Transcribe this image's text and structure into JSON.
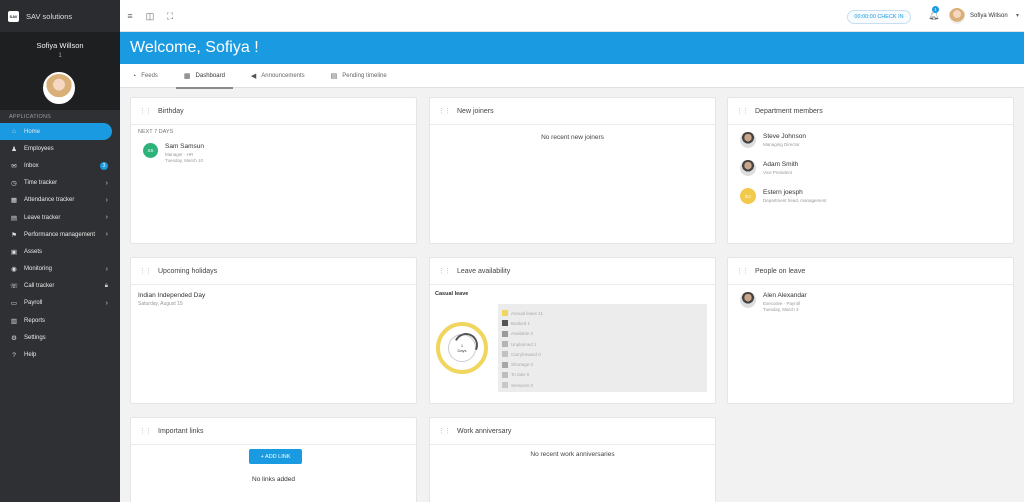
{
  "app": {
    "logo_text": "SAV",
    "name": "SAV solutions"
  },
  "profile": {
    "name": "Sofiya Willson",
    "subtitle": "1"
  },
  "sidebar": {
    "section_label": "APPLICATIONS",
    "items": [
      {
        "label": "Home",
        "icon": "home-icon",
        "glyph": "⌂",
        "active": true
      },
      {
        "label": "Employees",
        "icon": "employees-icon",
        "glyph": "♟"
      },
      {
        "label": "Inbox",
        "icon": "inbox-icon",
        "glyph": "✉",
        "badge": "3"
      },
      {
        "label": "Time tracker",
        "icon": "clock-icon",
        "glyph": "◷",
        "chevron": true
      },
      {
        "label": "Attendance tracker",
        "icon": "attendance-icon",
        "glyph": "▦",
        "chevron": true
      },
      {
        "label": "Leave tracker",
        "icon": "calendar-icon",
        "glyph": "▤",
        "chevron": true
      },
      {
        "label": "Performance management",
        "icon": "performance-icon",
        "glyph": "⚑",
        "chevron": true
      },
      {
        "label": "Assets",
        "icon": "assets-icon",
        "glyph": "▣"
      },
      {
        "label": "Monitoring",
        "icon": "eye-icon",
        "glyph": "◉",
        "chevron": true
      },
      {
        "label": "Call tracker",
        "icon": "phone-icon",
        "glyph": "☏",
        "lock": true
      },
      {
        "label": "Payroll",
        "icon": "wallet-icon",
        "glyph": "▭",
        "chevron": true
      },
      {
        "label": "Reports",
        "icon": "report-icon",
        "glyph": "▥"
      },
      {
        "label": "Settings",
        "icon": "gear-icon",
        "glyph": "⚙"
      },
      {
        "label": "Help",
        "icon": "help-icon",
        "glyph": "?"
      }
    ]
  },
  "topbar": {
    "checkin_label": "00:00:00 CHECK IN",
    "notification_count": "1",
    "user_name": "Sofiya Willson"
  },
  "banner": {
    "title": "Welcome, Sofiya !"
  },
  "tabs": [
    {
      "label": "Feeds",
      "icon": "rss-icon",
      "glyph": "◔"
    },
    {
      "label": "Dashboard",
      "icon": "dashboard-icon",
      "glyph": "▦",
      "active": true
    },
    {
      "label": "Announcements",
      "icon": "megaphone-icon",
      "glyph": "◀"
    },
    {
      "label": "Pending timeline",
      "icon": "timeline-icon",
      "glyph": "▤"
    }
  ],
  "cards": {
    "birthday": {
      "title": "Birthday",
      "subheading": "NEXT 7 DAYS",
      "person": {
        "initials": "SS",
        "name": "Sam Samsun",
        "role": "Manager · HR",
        "date": "Tuesday, March 10"
      }
    },
    "new_joiners": {
      "title": "New joiners",
      "empty": "No recent new joiners"
    },
    "department": {
      "title": "Department members",
      "members": [
        {
          "name": "Steve Johnson",
          "role": "Managing Director"
        },
        {
          "name": "Adam Smith",
          "role": "Vice President"
        },
        {
          "name": "Estern joesph",
          "role": "Department head, management",
          "initials": "EJ"
        }
      ]
    },
    "holidays": {
      "title": "Upcoming holidays",
      "name": "Indian Independed Day",
      "date": "Saturday, August 15"
    },
    "leave": {
      "title": "Leave availability",
      "type": "Casual leave",
      "donut_value": "1",
      "donut_unit": "Days",
      "legend": [
        {
          "label": "Annual leave 11",
          "color": "#f0d65e"
        },
        {
          "label": "Booked 1",
          "color": "#555555"
        },
        {
          "label": "Available 3",
          "color": "#9a9a9a"
        },
        {
          "label": "Unplanned 1",
          "color": "#b5b5b5"
        },
        {
          "label": "Carryforward 0",
          "color": "#c2c2c2"
        },
        {
          "label": "Shortage 0",
          "color": "#a8a8a8"
        },
        {
          "label": "To take 0",
          "color": "#bdbdbd"
        },
        {
          "label": "Sessions 0",
          "color": "#c8c8c8"
        }
      ]
    },
    "on_leave": {
      "title": "People on leave",
      "person": {
        "name": "Alen Alexandar",
        "role": "Executive · Payroll",
        "date": "Tuesday, March 3"
      }
    },
    "links": {
      "title": "Important links",
      "button": "+ ADD LINK",
      "empty": "No links added"
    },
    "anniversary": {
      "title": "Work anniversary",
      "empty": "No recent work anniversaries"
    }
  }
}
